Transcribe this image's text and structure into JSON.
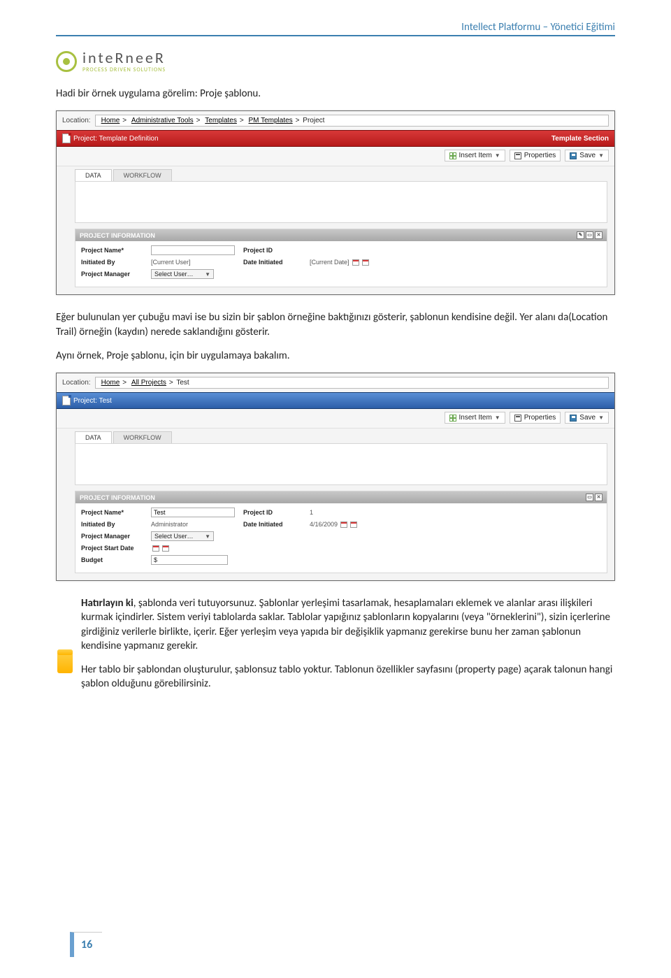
{
  "header": {
    "title": "Intellect Platformu – Yönetici Eğitimi",
    "logo_name": "inteRneeR",
    "logo_tag": "PROCESS DRIVEN SOLUTIONS"
  },
  "para1": "Hadi bir örnek uygulama görelim: Proje şablonu.",
  "para2": "Eğer bulunulan yer çubuğu mavi ise bu sizin bir şablon örneğine baktığınızı gösterir, şablonun kendisine değil. Yer alanı da(Location Trail) örneğin (kaydın) nerede saklandığını gösterir.",
  "para3": "Aynı örnek, Proje şablonu, için bir uygulamaya bakalım.",
  "note_para1_prefix": "Hatırlayın ki",
  "note_para1_rest": ", şablonda veri tutuyorsunuz. Şablonlar yerleşimi tasarlamak, hesaplamaları eklemek ve alanlar arası ilişkileri kurmak içindirler. Sistem veriyi tablolarda saklar. Tablolar yapığınız şablonların kopyalarını (veya \"örneklerini\"), sizin içerlerine girdiğiniz verilerle birlikte, içerir. Eğer yerleşim veya yapıda bir değişiklik yapmanız gerekirse bunu her zaman şablonun kendisine yapmanız gerekir.",
  "note_para2": "Her tablo bir şablondan oluşturulur, şablonsuz tablo yoktur. Tablonun özellikler sayfasını (property page) açarak talonun hangi şablon olduğunu görebilirsiniz.",
  "shot1": {
    "loc_label": "Location:",
    "crumbs": [
      "Home",
      "Administrative Tools",
      "Templates",
      "PM Templates",
      "Project"
    ],
    "bar_title": "Project: Template Definition",
    "bar_right": "Template Section",
    "toolbar": {
      "insert": "Insert Item",
      "prop": "Properties",
      "save": "Save"
    },
    "tabs": [
      "DATA",
      "WORKFLOW"
    ],
    "section": "PROJECT INFORMATION",
    "fields": {
      "name_label": "Project Name*",
      "name_value": "",
      "id_label": "Project ID",
      "id_value": "",
      "init_label": "Initiated By",
      "init_value": "[Current User]",
      "date_label": "Date Initiated",
      "date_value": "[Current Date]",
      "mgr_label": "Project Manager",
      "mgr_value": "Select User…"
    }
  },
  "shot2": {
    "loc_label": "Location:",
    "crumbs": [
      "Home",
      "All Projects",
      "Test"
    ],
    "bar_title": "Project: Test",
    "toolbar": {
      "insert": "Insert Item",
      "prop": "Properties",
      "save": "Save"
    },
    "tabs": [
      "DATA",
      "WORKFLOW"
    ],
    "section": "PROJECT INFORMATION",
    "fields": {
      "name_label": "Project Name*",
      "name_value": "Test",
      "id_label": "Project ID",
      "id_value": "1",
      "init_label": "Initiated By",
      "init_value": "Administrator",
      "date_label": "Date Initiated",
      "date_value": "4/16/2009",
      "mgr_label": "Project Manager",
      "mgr_value": "Select User…",
      "start_label": "Project Start Date",
      "budget_label": "Budget",
      "budget_prefix": "$"
    }
  },
  "page_number": "16"
}
